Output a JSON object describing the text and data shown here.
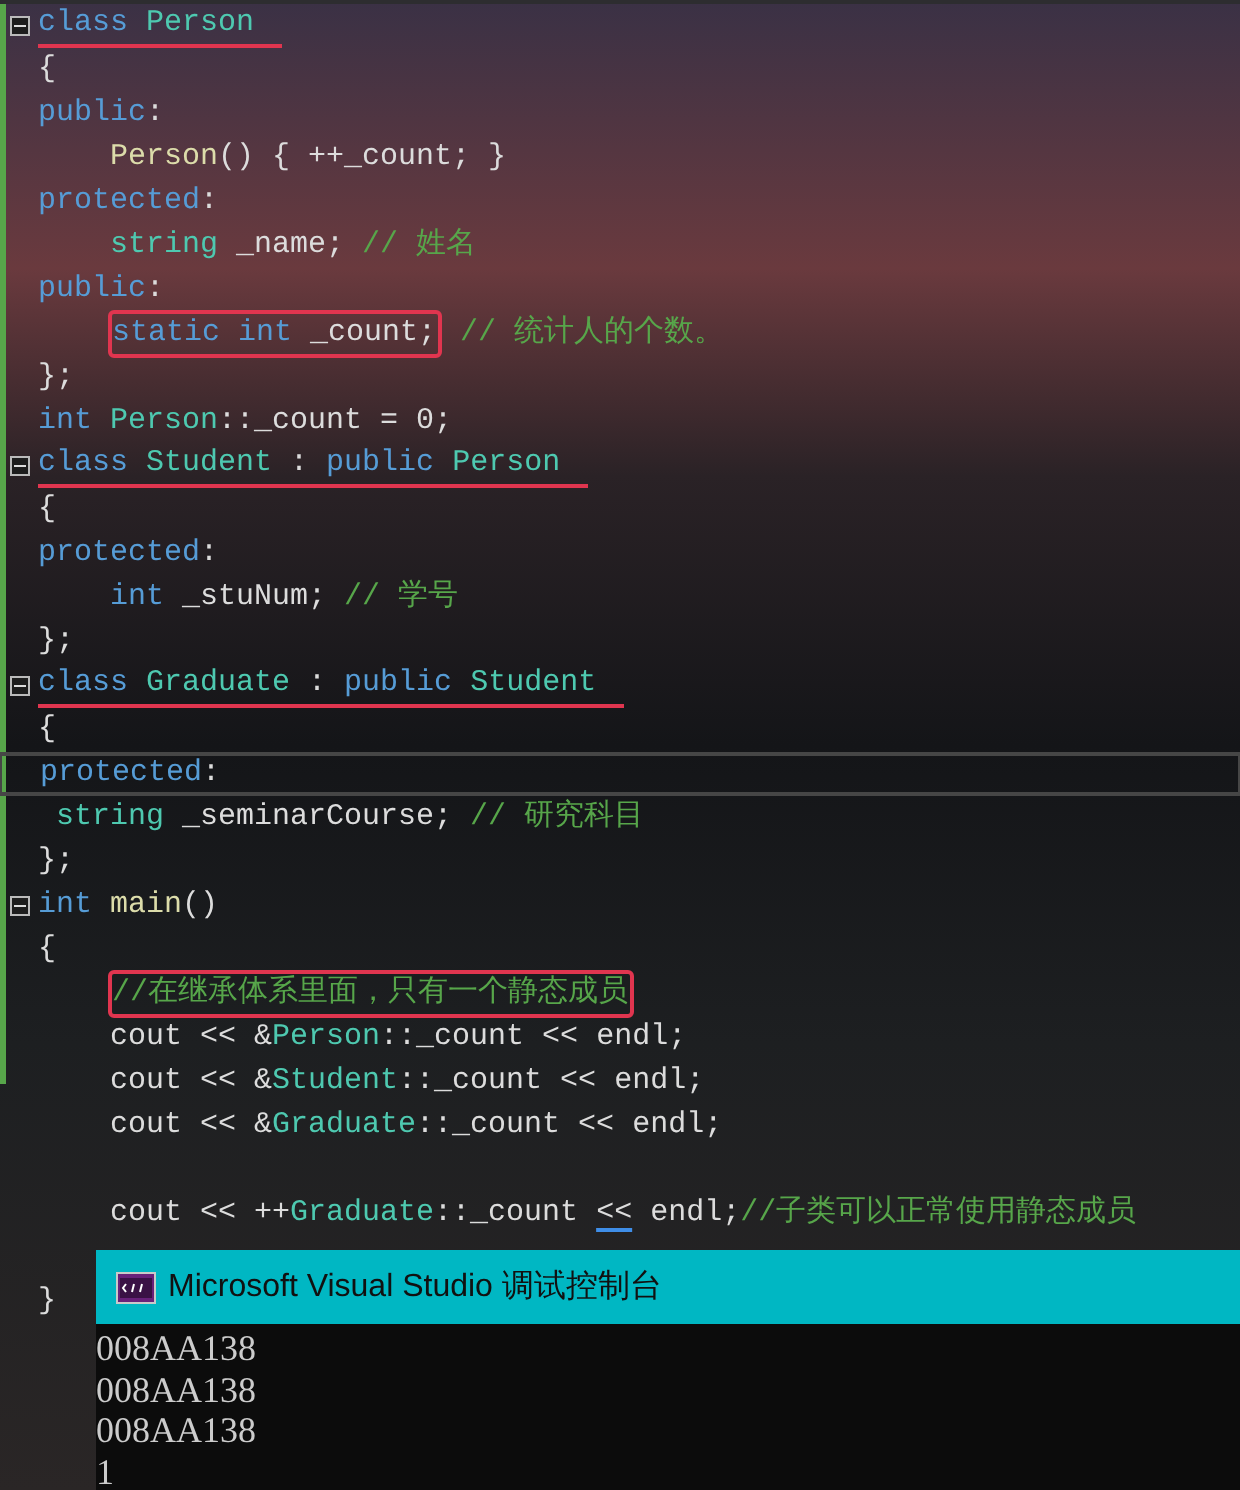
{
  "editor": {
    "lines": [
      {
        "fold": true,
        "underlined": true,
        "tokens": [
          {
            "kind": "keyword",
            "text": "class "
          },
          {
            "kind": "type",
            "text": "Person"
          }
        ]
      },
      {
        "tokens": [
          {
            "kind": "plain",
            "text": "{"
          }
        ]
      },
      {
        "tokens": [
          {
            "kind": "keyword",
            "text": "public"
          },
          {
            "kind": "plain",
            "text": ":"
          }
        ]
      },
      {
        "tokens": [
          {
            "kind": "func",
            "text": "    Person"
          },
          {
            "kind": "plain",
            "text": "() { ++_count; }"
          }
        ]
      },
      {
        "tokens": [
          {
            "kind": "keyword",
            "text": "protected"
          },
          {
            "kind": "plain",
            "text": ":"
          }
        ]
      },
      {
        "tokens": [
          {
            "kind": "type",
            "text": "    string"
          },
          {
            "kind": "plain",
            "text": " _name; "
          },
          {
            "kind": "comment",
            "text": "// 姓名"
          }
        ]
      },
      {
        "tokens": [
          {
            "kind": "keyword",
            "text": "public"
          },
          {
            "kind": "plain",
            "text": ":"
          }
        ]
      },
      {
        "indented": true,
        "tokens": [
          {
            "kind": "keyword",
            "text": "static int ",
            "boxed": true
          },
          {
            "kind": "plain",
            "text": "_count;",
            "boxed": true
          },
          {
            "kind": "comment",
            "text": "// 统计人的个数。"
          }
        ]
      },
      {
        "tokens": [
          {
            "kind": "plain",
            "text": "};"
          }
        ]
      },
      {
        "tokens": [
          {
            "kind": "keyword",
            "text": "int "
          },
          {
            "kind": "type",
            "text": "Person"
          },
          {
            "kind": "plain",
            "text": "::_count = 0;"
          }
        ]
      },
      {
        "fold": true,
        "underlined": true,
        "tokens": [
          {
            "kind": "keyword",
            "text": "class "
          },
          {
            "kind": "type",
            "text": "Student"
          },
          {
            "kind": "plain",
            "text": " : "
          },
          {
            "kind": "keyword",
            "text": "public "
          },
          {
            "kind": "type",
            "text": "Person"
          }
        ]
      },
      {
        "tokens": [
          {
            "kind": "plain",
            "text": "{"
          }
        ]
      },
      {
        "tokens": [
          {
            "kind": "keyword",
            "text": "protected"
          },
          {
            "kind": "plain",
            "text": ":"
          }
        ]
      },
      {
        "tokens": [
          {
            "kind": "keyword",
            "text": "    int"
          },
          {
            "kind": "plain",
            "text": " _stuNum; "
          },
          {
            "kind": "comment",
            "text": "// 学号"
          }
        ]
      },
      {
        "tokens": [
          {
            "kind": "plain",
            "text": "};"
          }
        ]
      },
      {
        "fold": true,
        "underlined": true,
        "tokens": [
          {
            "kind": "keyword",
            "text": "class "
          },
          {
            "kind": "type",
            "text": "Graduate"
          },
          {
            "kind": "plain",
            "text": " : "
          },
          {
            "kind": "keyword",
            "text": "public "
          },
          {
            "kind": "type",
            "text": "Student"
          }
        ]
      },
      {
        "tokens": [
          {
            "kind": "plain",
            "text": "{"
          }
        ]
      },
      {
        "current": true,
        "tokens": [
          {
            "kind": "keyword",
            "text": "protected"
          },
          {
            "kind": "plain",
            "text": ":"
          }
        ]
      },
      {
        "tokens": [
          {
            "kind": "type",
            "text": " string"
          },
          {
            "kind": "plain",
            "text": " _seminarCourse; "
          },
          {
            "kind": "comment",
            "text": "// 研究科目"
          }
        ]
      },
      {
        "tokens": [
          {
            "kind": "plain",
            "text": "};"
          }
        ]
      },
      {
        "fold": true,
        "tokens": [
          {
            "kind": "keyword",
            "text": "int "
          },
          {
            "kind": "func",
            "text": "main"
          },
          {
            "kind": "plain",
            "text": "()"
          }
        ]
      },
      {
        "tokens": [
          {
            "kind": "plain",
            "text": "{"
          }
        ]
      },
      {
        "indented": true,
        "tokens": [
          {
            "kind": "comment",
            "text": "//在继承体系里面，只有一个静态成员",
            "boxed": true
          }
        ]
      },
      {
        "tokens": [
          {
            "kind": "plain",
            "text": "    cout << &"
          },
          {
            "kind": "type",
            "text": "Person"
          },
          {
            "kind": "plain",
            "text": "::_count << endl;"
          }
        ]
      },
      {
        "tokens": [
          {
            "kind": "plain",
            "text": "    cout << &"
          },
          {
            "kind": "type",
            "text": "Student"
          },
          {
            "kind": "plain",
            "text": "::_count << endl;"
          }
        ]
      },
      {
        "tokens": [
          {
            "kind": "plain",
            "text": "    cout << &"
          },
          {
            "kind": "type",
            "text": "Graduate"
          },
          {
            "kind": "plain",
            "text": "::_count << endl;"
          }
        ]
      },
      {
        "blank": true
      },
      {
        "tokens": [
          {
            "kind": "plain",
            "text": "    cout << ++"
          },
          {
            "kind": "type",
            "text": "Graduate"
          },
          {
            "kind": "plain",
            "text": "::_count "
          },
          {
            "kind": "plain",
            "text": "<<",
            "squiggle": true
          },
          {
            "kind": "plain",
            "text": " endl;"
          },
          {
            "kind": "comment",
            "text": "//子类可以正常使用静态成员"
          }
        ]
      },
      {
        "blank": true
      },
      {
        "tokens": [
          {
            "kind": "plain",
            "text": "}"
          }
        ]
      }
    ]
  },
  "console": {
    "title": "Microsoft Visual Studio 调试控制台",
    "output": [
      "008AA138",
      "008AA138",
      "008AA138",
      "1"
    ]
  }
}
